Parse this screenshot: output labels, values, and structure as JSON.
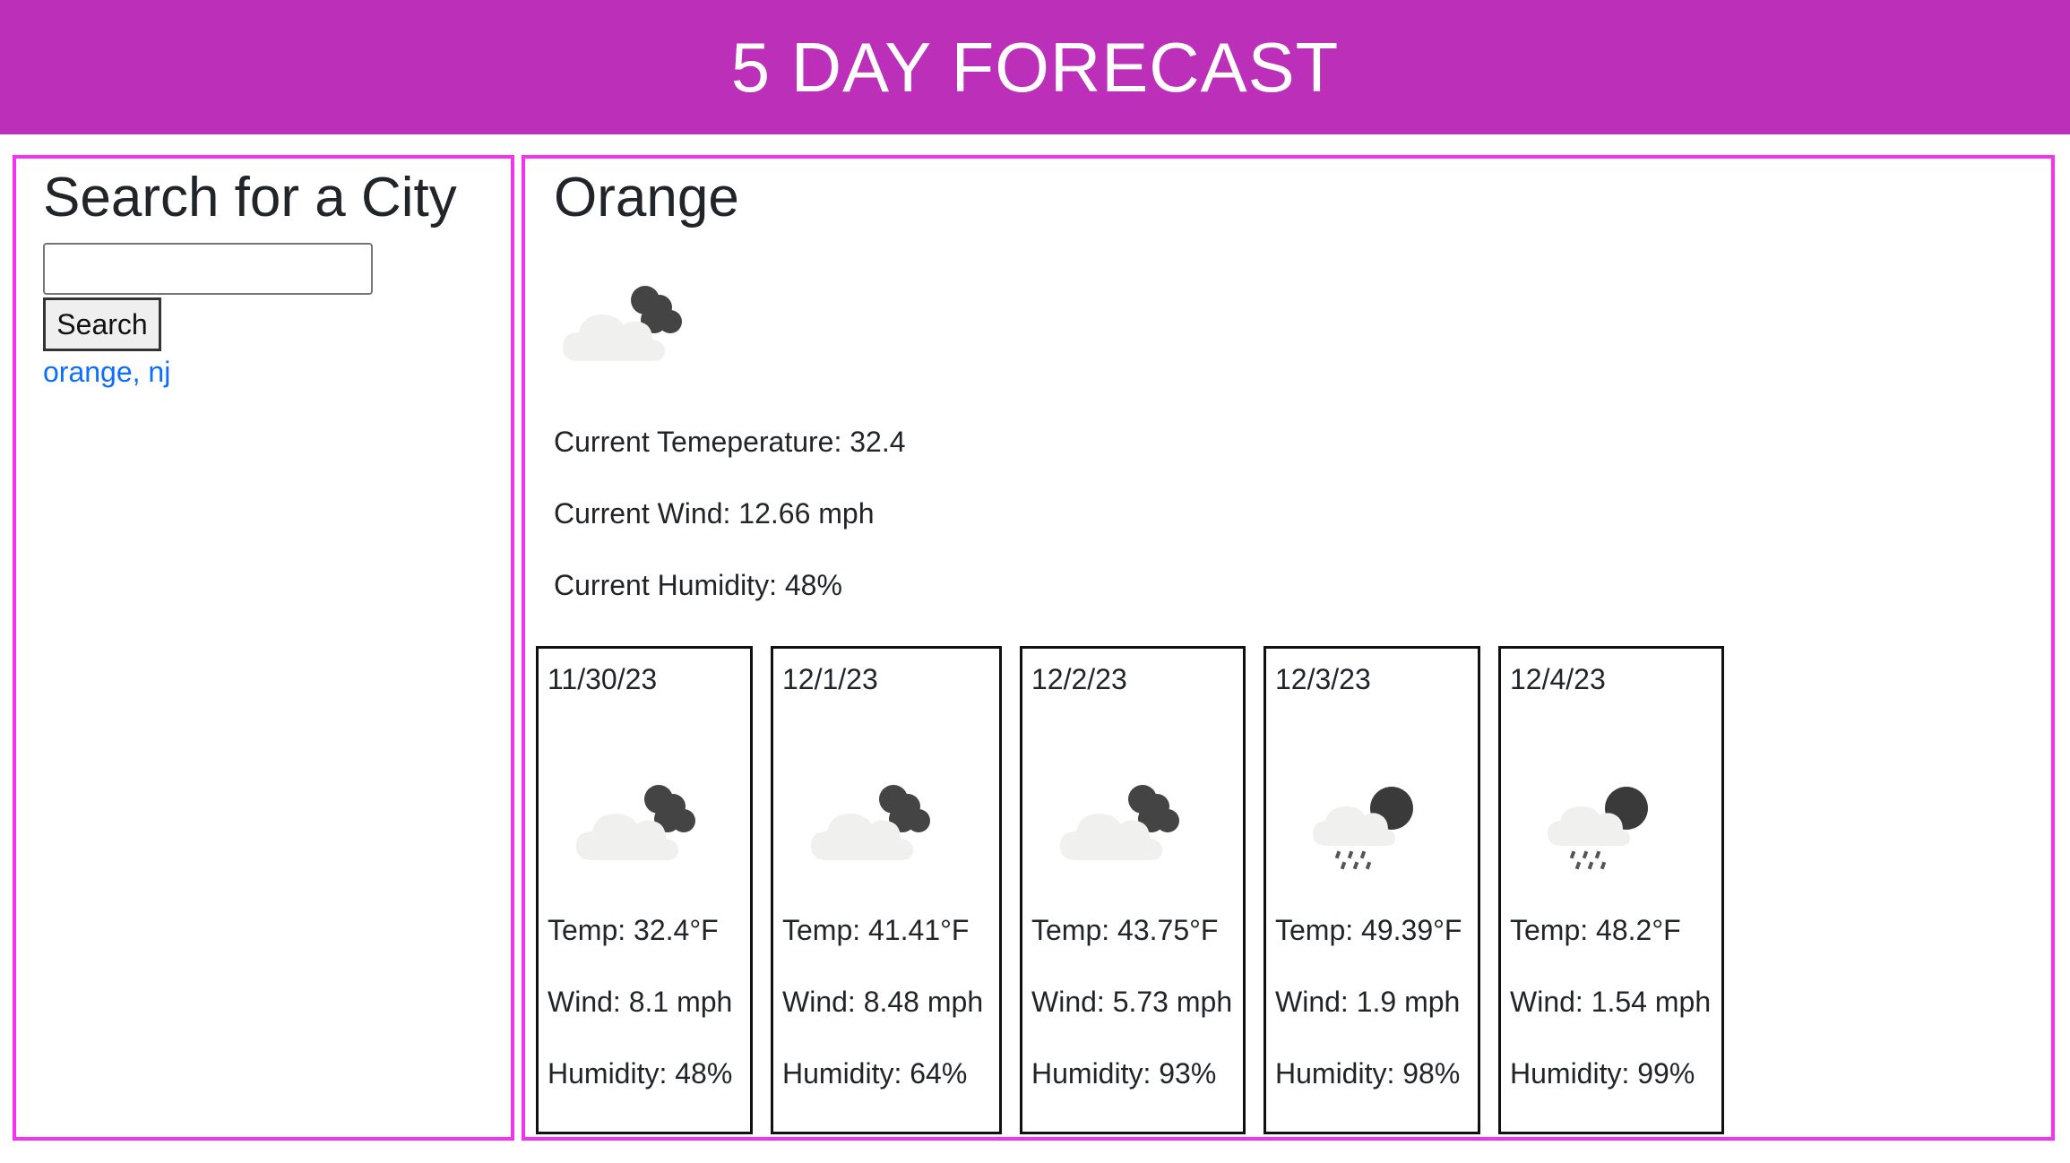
{
  "header": {
    "title": "5 DAY FORECAST"
  },
  "sidebar": {
    "heading": "Search for a City",
    "search_placeholder": "",
    "search_value": "",
    "search_button_label": "Search",
    "history": [
      "orange, nj"
    ]
  },
  "current": {
    "city": "Orange",
    "icon": "cloudy-night-icon",
    "temperature_text": "Current Temeperature: 32.4",
    "wind_text": "Current Wind: 12.66 mph",
    "humidity_text": "Current Humidity: 48%"
  },
  "forecast": [
    {
      "date": "11/30/23",
      "icon": "cloudy-night-icon",
      "temp": "Temp: 32.4°F",
      "wind": "Wind: 8.1 mph",
      "humidity": "Humidity: 48%"
    },
    {
      "date": "12/1/23",
      "icon": "cloudy-night-icon",
      "temp": "Temp: 41.41°F",
      "wind": "Wind: 8.48 mph",
      "humidity": "Humidity: 64%"
    },
    {
      "date": "12/2/23",
      "icon": "cloudy-night-icon",
      "temp": "Temp: 43.75°F",
      "wind": "Wind: 5.73 mph",
      "humidity": "Humidity: 93%"
    },
    {
      "date": "12/3/23",
      "icon": "rain-night-icon",
      "temp": "Temp: 49.39°F",
      "wind": "Wind: 1.9 mph",
      "humidity": "Humidity: 98%"
    },
    {
      "date": "12/4/23",
      "icon": "rain-night-icon",
      "temp": "Temp: 48.2°F",
      "wind": "Wind: 1.54 mph",
      "humidity": "Humidity: 99%"
    }
  ],
  "colors": {
    "header_bg": "#bb2fb9",
    "panel_border": "#f532f0",
    "link": "#0d6efd"
  }
}
